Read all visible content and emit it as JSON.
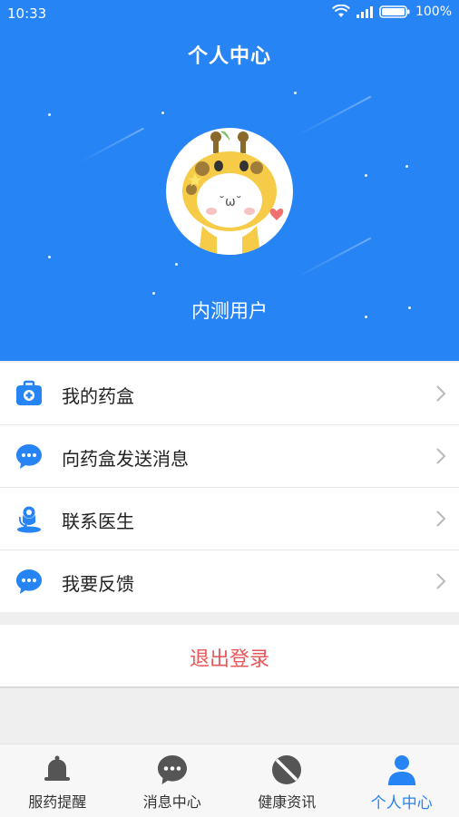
{
  "status_bar": {
    "time": "10:33",
    "battery": "100%"
  },
  "header": {
    "title": "个人中心",
    "username": "内测用户"
  },
  "menu": [
    {
      "label": "我的药盒",
      "icon": "medicine-box-icon"
    },
    {
      "label": "向药盒发送消息",
      "icon": "chat-bubble-icon"
    },
    {
      "label": "联系医生",
      "icon": "doctor-icon"
    },
    {
      "label": "我要反馈",
      "icon": "feedback-bubble-icon"
    }
  ],
  "logout_label": "退出登录",
  "tabs": [
    {
      "label": "服药提醒",
      "icon": "bell-icon",
      "active": false
    },
    {
      "label": "消息中心",
      "icon": "message-icon",
      "active": false
    },
    {
      "label": "健康资讯",
      "icon": "news-icon",
      "active": false
    },
    {
      "label": "个人中心",
      "icon": "person-icon",
      "active": true
    }
  ],
  "colors": {
    "primary": "#2684f4",
    "logout": "#e8575a"
  }
}
